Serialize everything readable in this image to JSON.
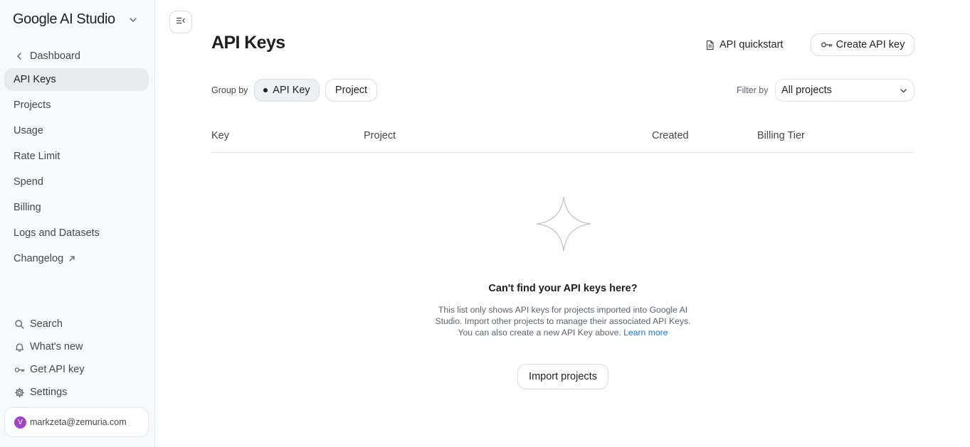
{
  "sidebar": {
    "brand": "Google AI Studio",
    "back_label": "Dashboard",
    "items": [
      {
        "label": "API Keys",
        "active": true
      },
      {
        "label": "Projects"
      },
      {
        "label": "Usage"
      },
      {
        "label": "Rate Limit"
      },
      {
        "label": "Spend"
      },
      {
        "label": "Billing"
      },
      {
        "label": "Logs and Datasets"
      },
      {
        "label": "Changelog",
        "icon": "external-link-icon"
      }
    ],
    "bottom_items": [
      {
        "label": "Search",
        "icon": "search-icon"
      },
      {
        "label": "What's new",
        "icon": "bell-icon"
      },
      {
        "label": "Get API key",
        "icon": "key-icon"
      },
      {
        "label": "Settings",
        "icon": "gear-icon"
      }
    ],
    "user": {
      "initial": "V",
      "email": "markzeta@zemuria.com",
      "avatar_color": "#a142c9"
    }
  },
  "header": {
    "title": "API Keys",
    "quickstart_label": "API quickstart",
    "create_label": "Create API key"
  },
  "toolbar": {
    "group_by_label": "Group by",
    "group_options": [
      {
        "label": "API Key",
        "selected": true
      },
      {
        "label": "Project",
        "selected": false
      }
    ],
    "filter_label": "Filter by",
    "filter_value": "All projects"
  },
  "table": {
    "columns": [
      "Key",
      "Project",
      "Created",
      "Billing Tier"
    ]
  },
  "empty_state": {
    "title": "Can't find your API keys here?",
    "description_line1": "This list only shows API keys for projects imported into Google AI",
    "description_line2": "Studio. Import other projects to manage their associated API Keys.",
    "description_line3": "You can also create a new API Key above.",
    "learn_more": "Learn more",
    "import_label": "Import projects"
  },
  "colors": {
    "accent_link": "#1a73e8",
    "sidebar_bg": "#f8f9fa",
    "active_item_bg": "#e8eaed"
  }
}
